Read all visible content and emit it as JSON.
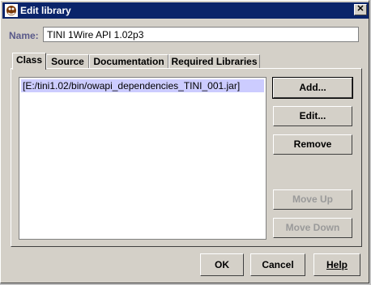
{
  "window": {
    "title": "Edit library",
    "title_icon": "library-app-icon",
    "close_glyph": "✕"
  },
  "name": {
    "label": "Name:",
    "value": "TINI 1Wire API 1.02p3"
  },
  "tabs": [
    {
      "label": "Class",
      "active": true
    },
    {
      "label": "Source",
      "active": false
    },
    {
      "label": "Documentation",
      "active": false
    },
    {
      "label": "Required Libraries",
      "active": false
    }
  ],
  "class_list": {
    "items": [
      "[E:/tini1.02/bin/owapi_dependencies_TINI_001.jar]"
    ],
    "selected_index": 0
  },
  "side_buttons": {
    "add": "Add...",
    "edit": "Edit...",
    "remove": "Remove",
    "move_up": "Move Up",
    "move_down": "Move Down"
  },
  "footer_buttons": {
    "ok": "OK",
    "cancel": "Cancel",
    "help": "Help"
  },
  "colors": {
    "titlebar": "#0a246a",
    "face": "#d4d0c8",
    "selection": "#ccccff",
    "label": "#5a5a8a",
    "disabled_text": "#9a9a9a"
  }
}
